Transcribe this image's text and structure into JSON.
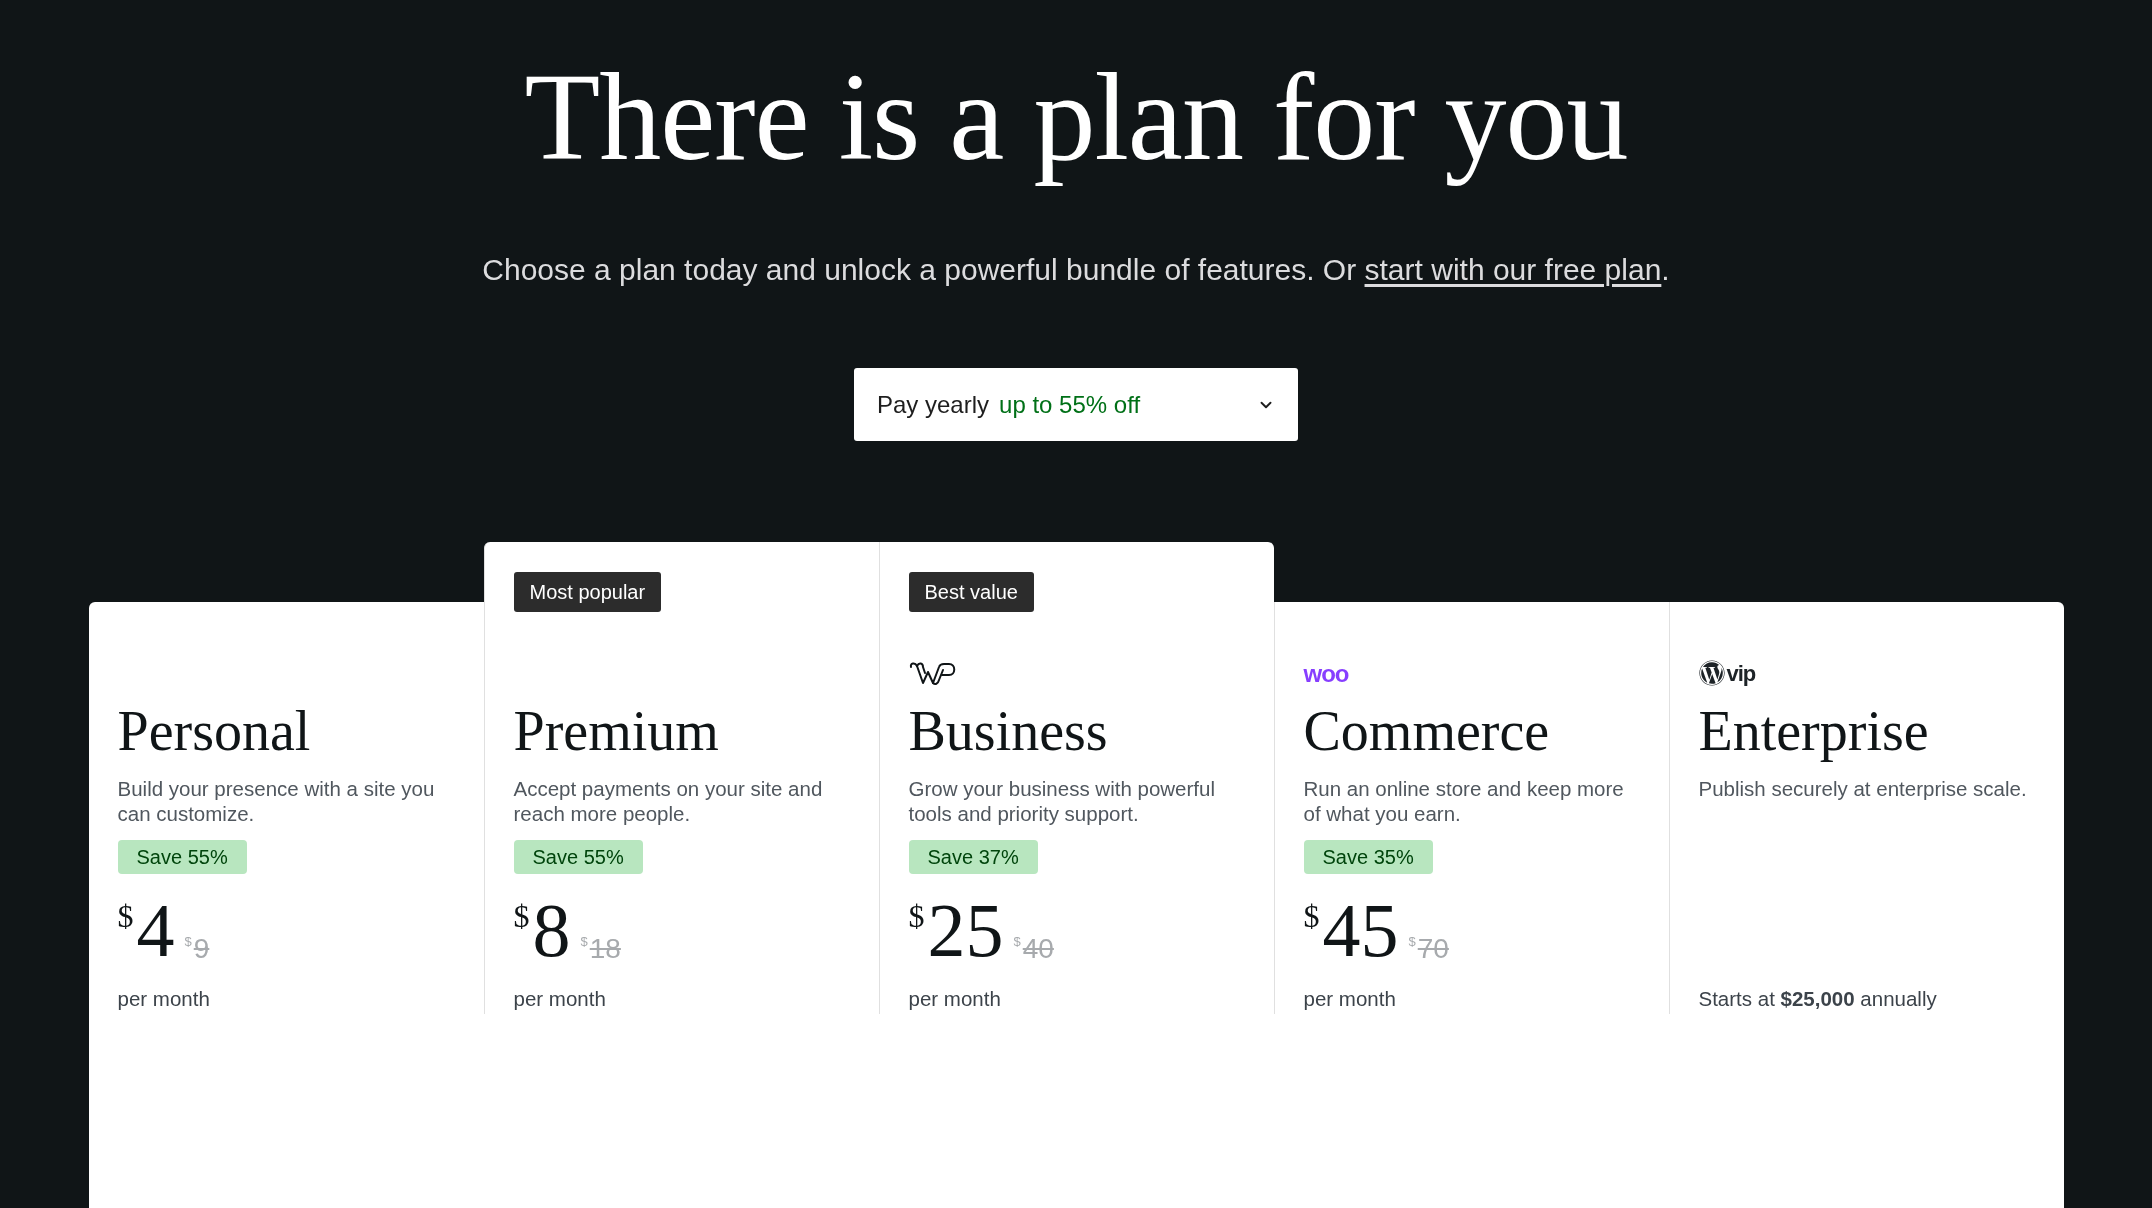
{
  "heading": "There is a plan for you",
  "subheading": {
    "text": "Choose a plan today and unlock a powerful bundle of features. Or ",
    "link": "start with our free plan",
    "after": "."
  },
  "billing_select": {
    "label": "Pay yearly",
    "discount": "up to 55% off"
  },
  "plans": [
    {
      "name": "Personal",
      "description": "Build your presence with a site you can customize.",
      "save": "Save 55%",
      "price": {
        "currency": "$",
        "amount": "4",
        "old_currency": "$",
        "old_amount": "9"
      },
      "period": "per month"
    },
    {
      "badge": "Most popular",
      "name": "Premium",
      "description": "Accept payments on your site and reach more people.",
      "save": "Save 55%",
      "price": {
        "currency": "$",
        "amount": "8",
        "old_currency": "$",
        "old_amount": "18"
      },
      "period": "per month"
    },
    {
      "badge": "Best value",
      "logo": {
        "kind": "wp-outline"
      },
      "name": "Business",
      "description": "Grow your business with powerful tools and priority support.",
      "save": "Save 37%",
      "price": {
        "currency": "$",
        "amount": "25",
        "old_currency": "$",
        "old_amount": "40"
      },
      "period": "per month"
    },
    {
      "logo": {
        "kind": "woo",
        "text": "woo"
      },
      "name": "Commerce",
      "description": "Run an online store and keep more of what you earn.",
      "save": "Save 35%",
      "price": {
        "currency": "$",
        "amount": "45",
        "old_currency": "$",
        "old_amount": "70"
      },
      "period": "per month"
    },
    {
      "logo": {
        "kind": "wpvip",
        "text": "vip"
      },
      "name": "Enterprise",
      "description": "Publish securely at enterprise scale.",
      "price_note": "Starts at **$25,000** annually"
    }
  ]
}
